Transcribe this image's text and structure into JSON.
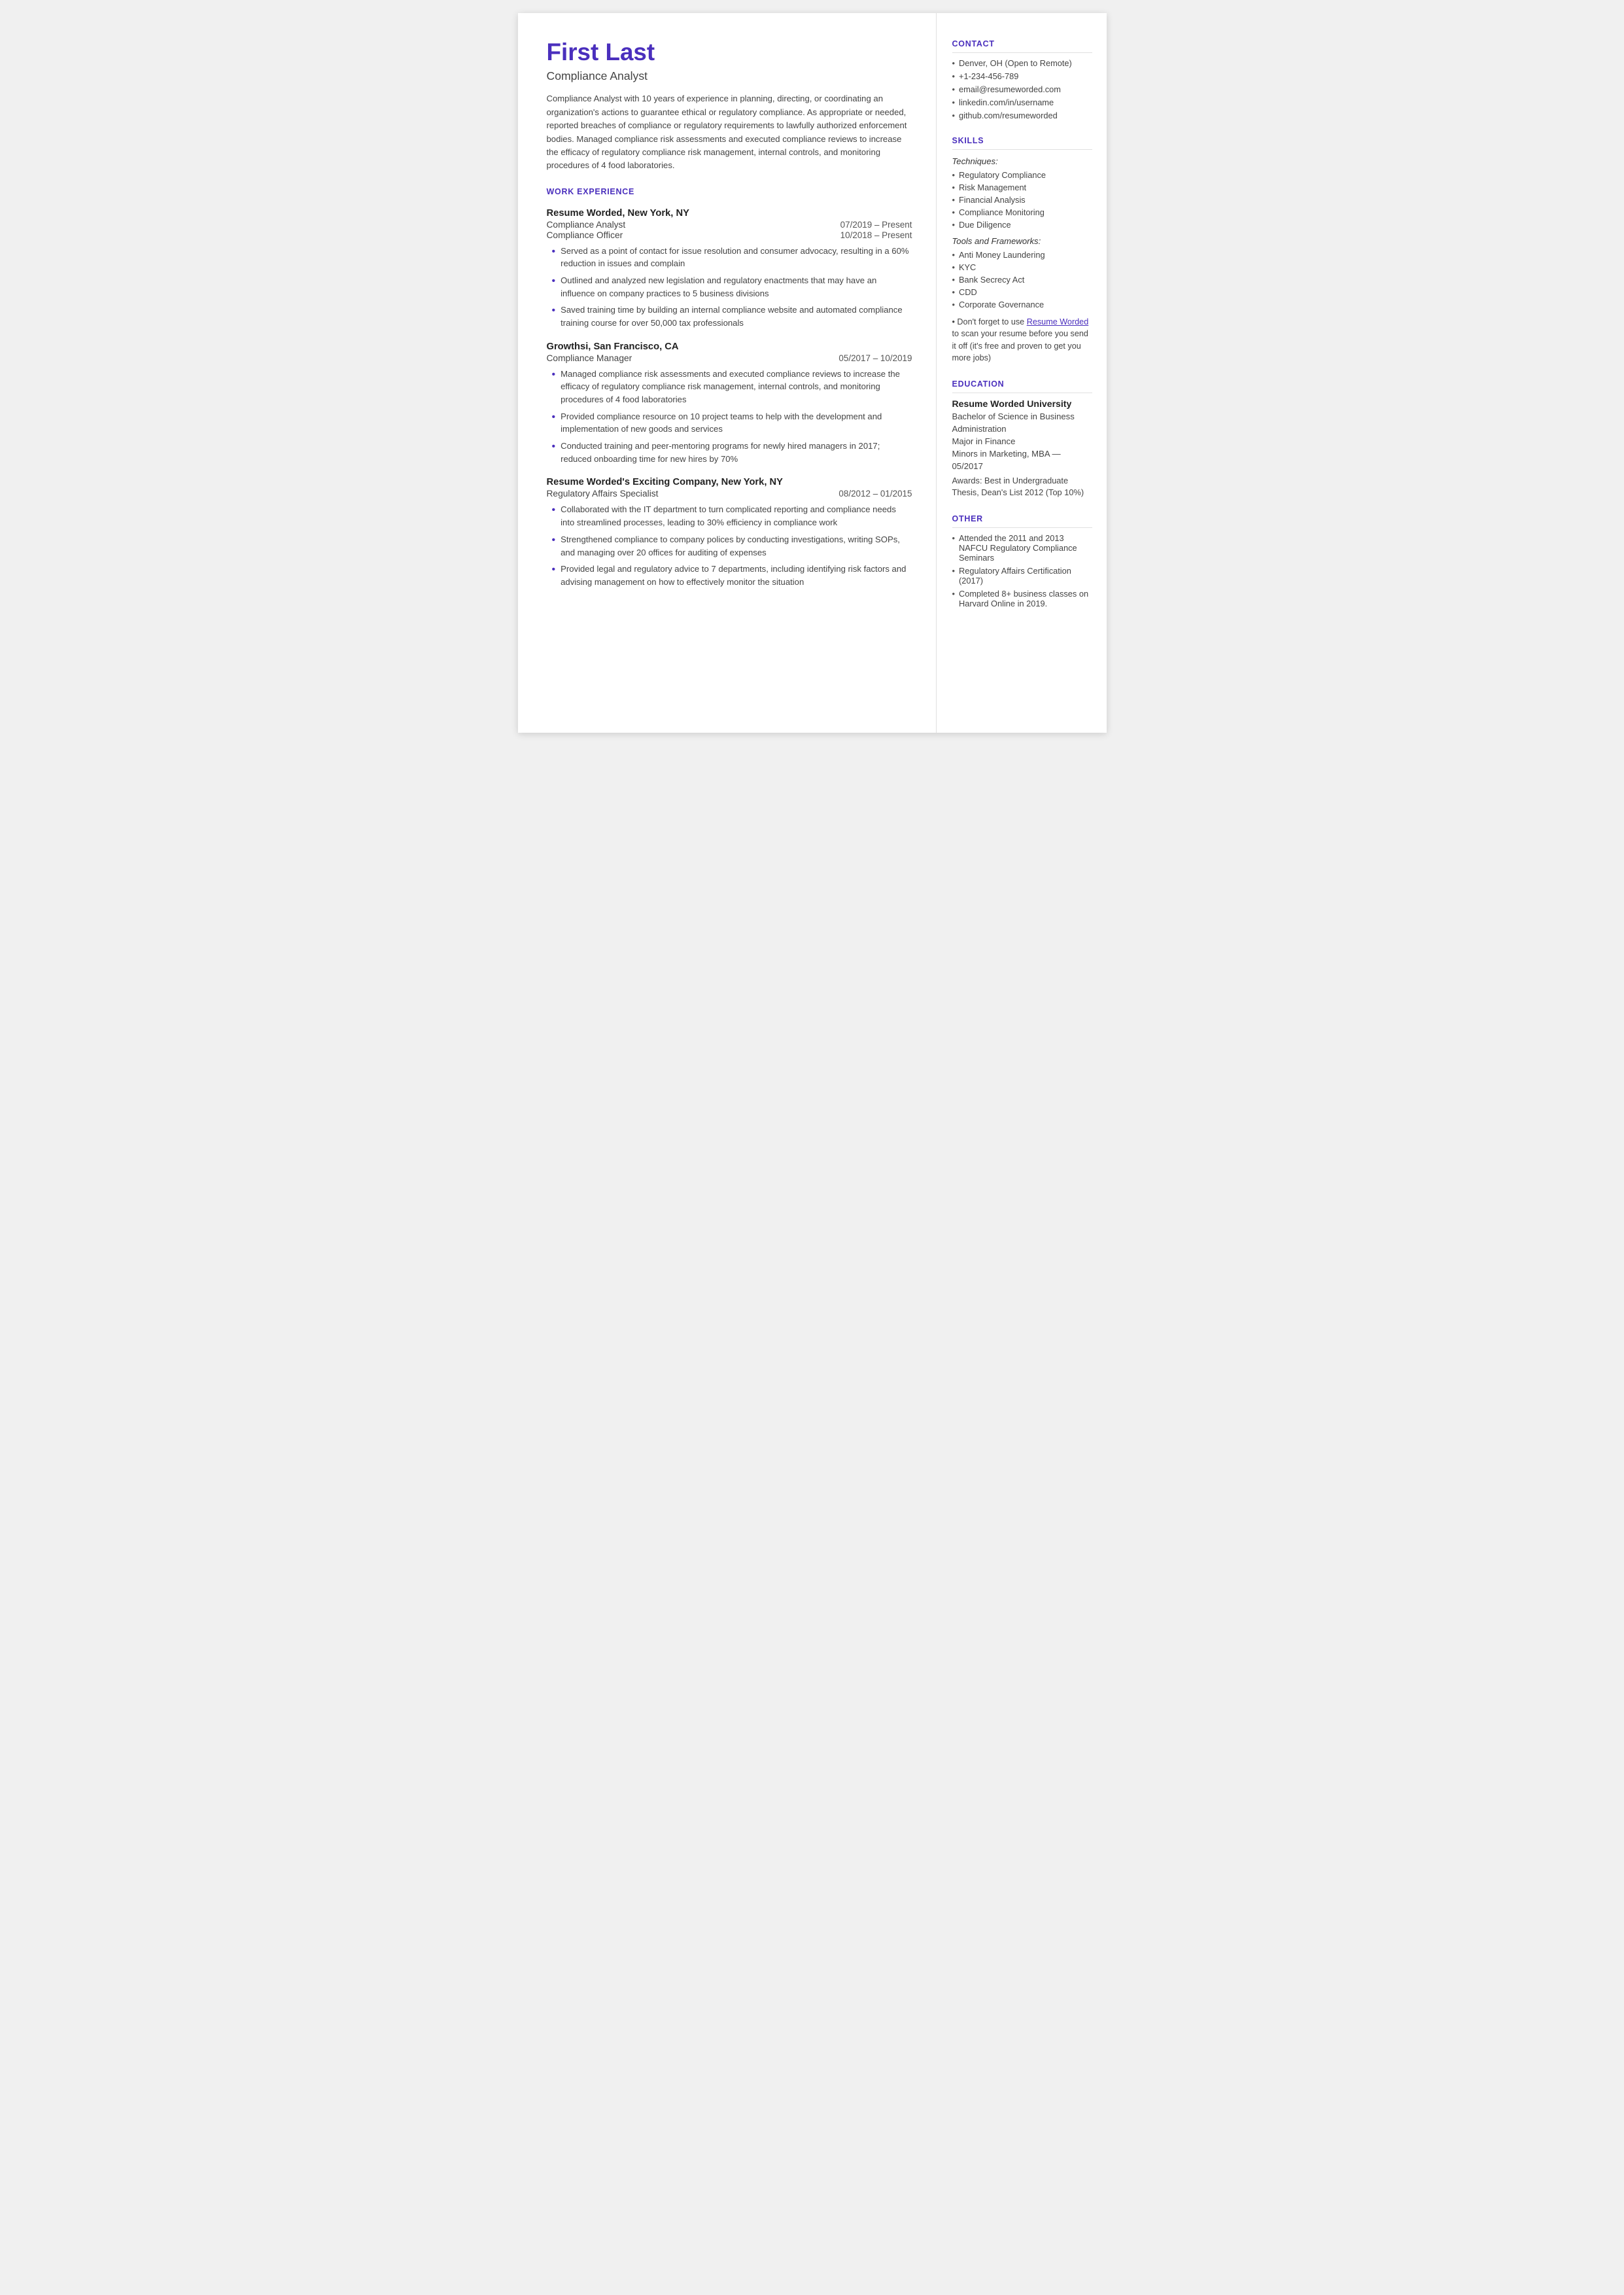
{
  "left": {
    "name": "First Last",
    "title": "Compliance Analyst",
    "summary": "Compliance Analyst with 10 years of experience in planning, directing, or coordinating an organization's actions to guarantee ethical or regulatory compliance. As appropriate or needed, reported breaches of compliance or regulatory requirements to lawfully authorized enforcement bodies. Managed compliance risk assessments and executed compliance reviews to increase the efficacy of regulatory compliance risk management, internal controls, and monitoring procedures of 4 food laboratories.",
    "work_experience_heading": "WORK EXPERIENCE",
    "jobs": [
      {
        "company": "Resume Worded, New York, NY",
        "roles": [
          {
            "title": "Compliance Analyst",
            "dates": "07/2019 – Present"
          },
          {
            "title": "Compliance Officer",
            "dates": "10/2018 – Present"
          }
        ],
        "bullets": [
          "Served as a point of contact for issue resolution and consumer advocacy, resulting in a 60% reduction in issues and complain",
          "Outlined and analyzed new legislation and regulatory enactments that may have an influence on company practices to 5 business divisions",
          "Saved training time by building an internal compliance website and automated compliance training course for over 50,000 tax professionals"
        ]
      },
      {
        "company": "Growthsi, San Francisco, CA",
        "roles": [
          {
            "title": "Compliance Manager",
            "dates": "05/2017 – 10/2019"
          }
        ],
        "bullets": [
          "Managed compliance risk assessments and executed compliance reviews to increase the efficacy of regulatory compliance risk management, internal controls, and monitoring procedures of 4 food laboratories",
          "Provided compliance resource on 10 project teams to help with the development and implementation of new goods and services",
          "Conducted training and peer-mentoring programs for newly hired managers in 2017; reduced onboarding time for new hires by 70%"
        ]
      },
      {
        "company": "Resume Worded's Exciting Company, New York, NY",
        "roles": [
          {
            "title": "Regulatory Affairs Specialist",
            "dates": "08/2012 – 01/2015"
          }
        ],
        "bullets": [
          "Collaborated with the IT department to turn complicated reporting and compliance needs into streamlined processes, leading to 30% efficiency in compliance work",
          "Strengthened compliance to company polices by conducting investigations, writing SOPs, and managing over 20 offices for auditing of expenses",
          "Provided legal and regulatory advice to 7 departments, including identifying risk factors and advising management on how to effectively monitor the situation"
        ]
      }
    ]
  },
  "right": {
    "contact_heading": "CONTACT",
    "contact_items": [
      "Denver, OH (Open to Remote)",
      "+1-234-456-789",
      "email@resumeworded.com",
      "linkedin.com/in/username",
      "github.com/resumeworded"
    ],
    "skills_heading": "SKILLS",
    "techniques_label": "Techniques:",
    "techniques": [
      "Regulatory Compliance",
      "Risk Management",
      "Financial Analysis",
      "Compliance Monitoring",
      "Due Diligence"
    ],
    "tools_label": "Tools and Frameworks:",
    "tools": [
      "Anti Money Laundering",
      "KYC",
      "Bank Secrecy Act",
      "CDD",
      "Corporate Governance"
    ],
    "skills_note": "Don't forget to use Resume Worded to scan your resume before you send it off (it's free and proven to get you more jobs)",
    "skills_note_link_text": "Resume Worded",
    "education_heading": "EDUCATION",
    "education": {
      "school": "Resume Worded University",
      "degree": "Bachelor of Science in Business Administration",
      "major": "Major in Finance",
      "minors": "Minors in Marketing, MBA — 05/2017",
      "awards": "Awards: Best in Undergraduate Thesis, Dean's List 2012 (Top 10%)"
    },
    "other_heading": "OTHER",
    "other_items": [
      "Attended the 2011 and 2013 NAFCU Regulatory Compliance Seminars",
      "Regulatory Affairs Certification (2017)",
      "Completed 8+ business classes on Harvard Online in 2019."
    ]
  }
}
